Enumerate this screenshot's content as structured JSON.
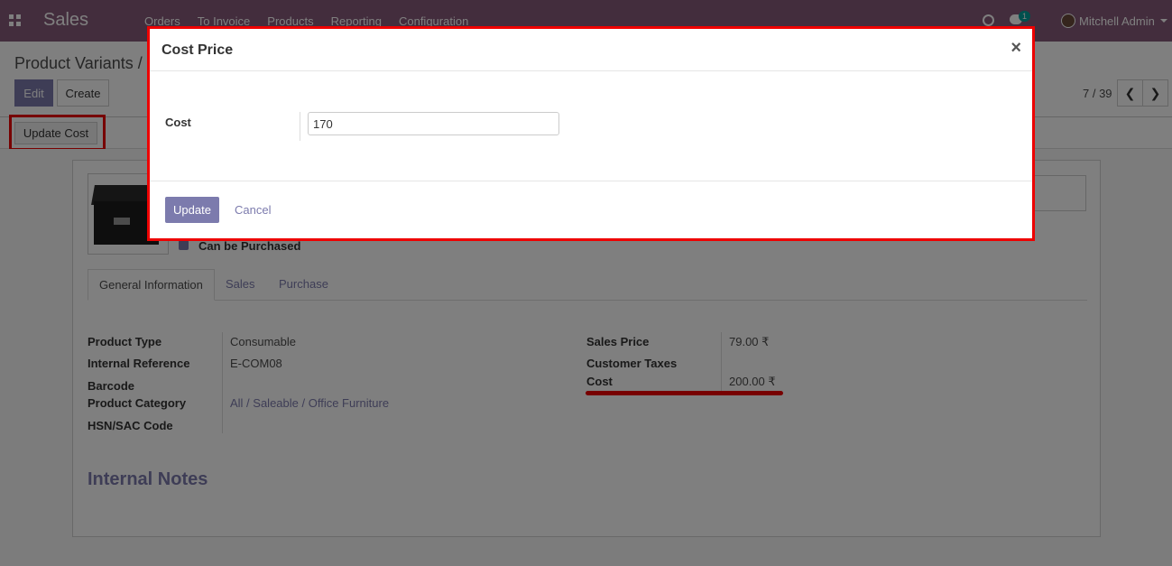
{
  "navbar": {
    "app_name": "Sales",
    "menu": [
      "Orders",
      "To Invoice",
      "Products",
      "Reporting",
      "Configuration"
    ],
    "chat_count": "1",
    "user_name": "Mitchell Admin"
  },
  "control_panel": {
    "breadcrumb": "Product Variants /",
    "edit_label": "Edit",
    "create_label": "Create",
    "pager": "7 / 39",
    "prev_label": "❮",
    "next_label": "❯"
  },
  "statusbar": {
    "update_cost_label": "Update Cost"
  },
  "form": {
    "can_be_purchased": "Can be Purchased",
    "tabs": [
      "General Information",
      "Sales",
      "Purchase"
    ],
    "left_fields": [
      {
        "label": "Product Type",
        "value": "Consumable"
      },
      {
        "label": "Internal Reference",
        "value": "E-COM08"
      },
      {
        "label": "Barcode",
        "value": ""
      },
      {
        "label": "Product Category",
        "value": "All / Saleable / Office Furniture"
      },
      {
        "label": "HSN/SAC Code",
        "value": ""
      }
    ],
    "right_fields": [
      {
        "label": "Sales Price",
        "value": "79.00 ₹"
      },
      {
        "label": "Customer Taxes",
        "value": ""
      },
      {
        "label": "Cost",
        "value": "200.00 ₹"
      }
    ],
    "internal_notes": "Internal Notes"
  },
  "modal": {
    "title": "Cost Price",
    "close": "×",
    "cost_label": "Cost",
    "cost_value": "170",
    "update_label": "Update",
    "cancel_label": "Cancel"
  },
  "colors": {
    "navbar": "#875a7b",
    "primary": "#7c7bad",
    "highlight": "#ee0000"
  }
}
